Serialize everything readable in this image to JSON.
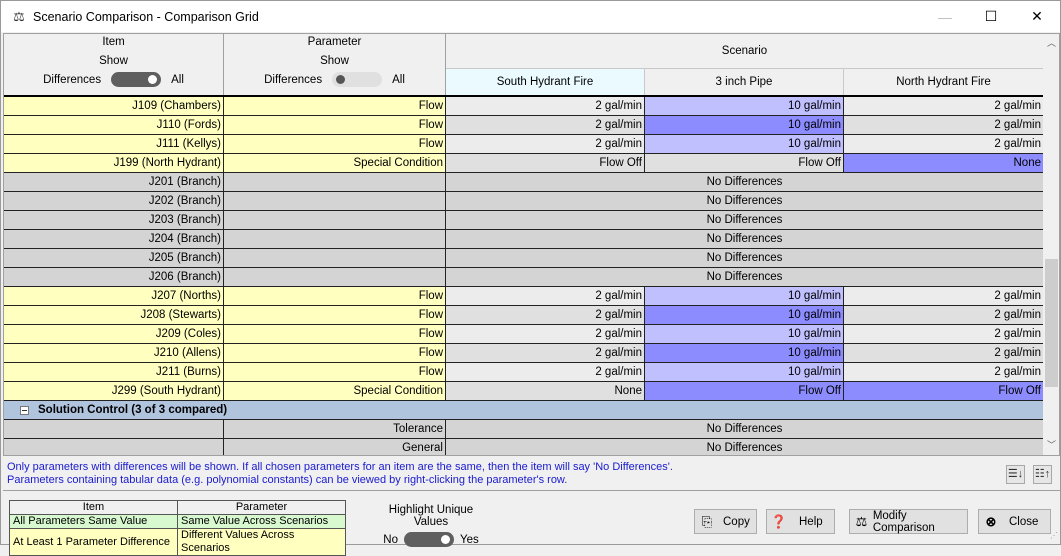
{
  "window": {
    "title": "Scenario Comparison - Comparison Grid",
    "icon": "scale-icon",
    "controls": {
      "minimize": "—",
      "maximize": "☐",
      "close": "✕"
    }
  },
  "header": {
    "item": {
      "label": "Item",
      "show": "Show",
      "left": "Differences",
      "right": "All",
      "toggle_state": "All"
    },
    "parameter": {
      "label": "Parameter",
      "show": "Show",
      "left": "Differences",
      "right": "All",
      "toggle_state": "Differences"
    },
    "scenario_label": "Scenario",
    "scenarios": [
      "South Hydrant Fire",
      "3 inch Pipe",
      "North Hydrant Fire"
    ]
  },
  "rows": [
    {
      "item": "J109 (Chambers)",
      "param": "Flow",
      "values": [
        "2 gal/min",
        "10 gal/min",
        "2 gal/min"
      ],
      "highlight": [
        0,
        1,
        0
      ]
    },
    {
      "item": "J110 (Fords)",
      "param": "Flow",
      "values": [
        "2 gal/min",
        "10 gal/min",
        "2 gal/min"
      ],
      "highlight": [
        0,
        2,
        0
      ]
    },
    {
      "item": "J111 (Kellys)",
      "param": "Flow",
      "values": [
        "2 gal/min",
        "10 gal/min",
        "2 gal/min"
      ],
      "highlight": [
        0,
        1,
        0
      ]
    },
    {
      "item": "J199 (North Hydrant)",
      "param": "Special Condition",
      "values": [
        "Flow Off",
        "Flow Off",
        "None"
      ],
      "highlight": [
        0,
        0,
        2
      ]
    },
    {
      "item": "J201 (Branch)",
      "param": "",
      "nodiff": "No Differences"
    },
    {
      "item": "J202 (Branch)",
      "param": "",
      "nodiff": "No Differences"
    },
    {
      "item": "J203 (Branch)",
      "param": "",
      "nodiff": "No Differences"
    },
    {
      "item": "J204 (Branch)",
      "param": "",
      "nodiff": "No Differences"
    },
    {
      "item": "J205 (Branch)",
      "param": "",
      "nodiff": "No Differences"
    },
    {
      "item": "J206 (Branch)",
      "param": "",
      "nodiff": "No Differences"
    },
    {
      "item": "J207 (Norths)",
      "param": "Flow",
      "values": [
        "2 gal/min",
        "10 gal/min",
        "2 gal/min"
      ],
      "highlight": [
        0,
        1,
        0
      ]
    },
    {
      "item": "J208 (Stewarts)",
      "param": "Flow",
      "values": [
        "2 gal/min",
        "10 gal/min",
        "2 gal/min"
      ],
      "highlight": [
        0,
        2,
        0
      ]
    },
    {
      "item": "J209 (Coles)",
      "param": "Flow",
      "values": [
        "2 gal/min",
        "10 gal/min",
        "2 gal/min"
      ],
      "highlight": [
        0,
        1,
        0
      ]
    },
    {
      "item": "J210 (Allens)",
      "param": "Flow",
      "values": [
        "2 gal/min",
        "10 gal/min",
        "2 gal/min"
      ],
      "highlight": [
        0,
        2,
        0
      ]
    },
    {
      "item": "J211 (Burns)",
      "param": "Flow",
      "values": [
        "2 gal/min",
        "10 gal/min",
        "2 gal/min"
      ],
      "highlight": [
        0,
        1,
        0
      ]
    },
    {
      "item": "J299 (South Hydrant)",
      "param": "Special Condition",
      "values": [
        "None",
        "Flow Off",
        "Flow Off"
      ],
      "highlight": [
        0,
        2,
        2
      ]
    }
  ],
  "group": {
    "label": "Solution Control (3 of 3 compared)",
    "expanded": true
  },
  "group_rows": [
    {
      "item": "",
      "param": "Tolerance",
      "nodiff": "No Differences"
    },
    {
      "item": "",
      "param": "General",
      "nodiff": "No Differences"
    }
  ],
  "info": {
    "line1": "Only parameters with differences will be shown. If all chosen parameters for an item are the same, then the item will say 'No Differences'.",
    "line2": "Parameters containing tabular data (e.g. polynomial constants) can be viewed by right-clicking the parameter's row.",
    "expand_all_icon": "expand-all-icon",
    "collapse_all_icon": "collapse-all-icon"
  },
  "legend": {
    "headers": [
      "Item",
      "Parameter"
    ],
    "row1": [
      "All Parameters Same Value",
      "Same Value Across Scenarios"
    ],
    "row2": [
      "At Least 1 Parameter Difference",
      "Different Values Across Scenarios"
    ]
  },
  "highlight_unique": {
    "label": "Highlight Unique Values",
    "no": "No",
    "yes": "Yes",
    "state": "Yes"
  },
  "buttons": {
    "copy": "Copy",
    "help": "Help",
    "modify": "Modify Comparison",
    "close": "Close"
  },
  "colors": {
    "item_diff": "#ffffc0",
    "item_same": "#d4d4d4",
    "unique_light": "#c0c0ff",
    "unique_dark": "#8c8cff",
    "group": "#b0c4de",
    "info_text": "#1a1ad0"
  }
}
